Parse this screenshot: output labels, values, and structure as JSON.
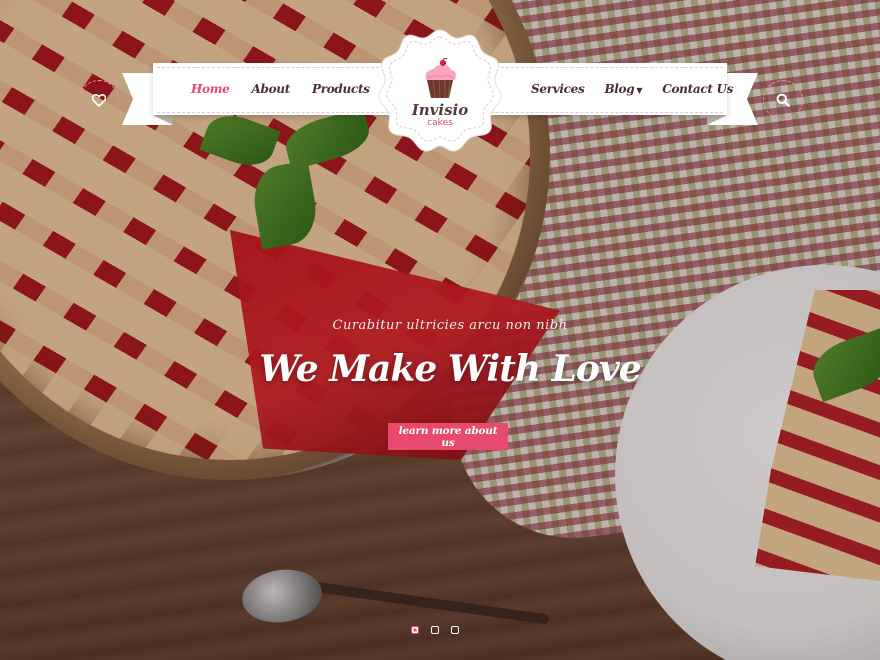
{
  "nav": {
    "left_items": [
      {
        "label": "Home",
        "active": true
      },
      {
        "label": "About",
        "active": false
      },
      {
        "label": "Products",
        "active": false
      }
    ],
    "right_items": [
      {
        "label": "Services",
        "active": false
      },
      {
        "label": "Blog",
        "active": false,
        "has_dropdown": true
      },
      {
        "label": "Contact Us",
        "active": false
      }
    ]
  },
  "logo": {
    "name": "Invisio",
    "subtitle": "cakes",
    "icon": "cupcake-icon"
  },
  "header_icons": {
    "left": "heart-icon",
    "right": "search-icon"
  },
  "hero": {
    "subtitle": "Curabitur ultricies arcu non nibh",
    "title": "We Make With Love",
    "button_label": "learn more about us"
  },
  "slider": {
    "total_slides": 3,
    "active_slide": 1
  },
  "colors": {
    "accent": "#e74a6d",
    "nav_text": "#4a2f2a",
    "logo_text": "#5a3a34"
  }
}
